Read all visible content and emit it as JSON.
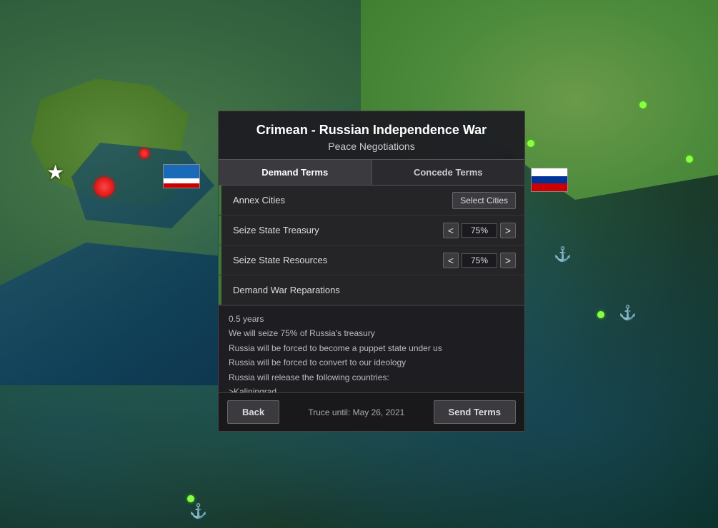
{
  "map": {
    "background_color": "#2a5a3a"
  },
  "dialog": {
    "title": "Crimean - Russian Independence War",
    "subtitle": "Peace Negotiations",
    "tabs": [
      {
        "id": "demand",
        "label": "Demand Terms",
        "active": true
      },
      {
        "id": "concede",
        "label": "Concede Terms",
        "active": false
      }
    ],
    "terms": [
      {
        "id": "annex_cities",
        "label": "Annex Cities",
        "control_type": "select_button",
        "control_label": "Select Cities"
      },
      {
        "id": "seize_treasury",
        "label": "Seize State Treasury",
        "control_type": "stepper",
        "value": "75%",
        "min_label": "<",
        "max_label": ">"
      },
      {
        "id": "seize_resources",
        "label": "Seize State Resources",
        "control_type": "stepper",
        "value": "75%",
        "min_label": "<",
        "max_label": ">"
      },
      {
        "id": "war_reparations",
        "label": "Demand War Reparations",
        "control_type": "none"
      }
    ],
    "summary": {
      "duration_text": "0.5 years",
      "lines": [
        "We will seize 75% of Russia's treasury",
        "Russia will be forced to become a puppet state under us",
        "Russia will be forced to convert to our ideology",
        "Russia will release the following countries:",
        ">Kaliningrad"
      ]
    },
    "footer": {
      "back_label": "Back",
      "truce_text": "Truce until: May 26, 2021",
      "send_label": "Send Terms"
    }
  }
}
